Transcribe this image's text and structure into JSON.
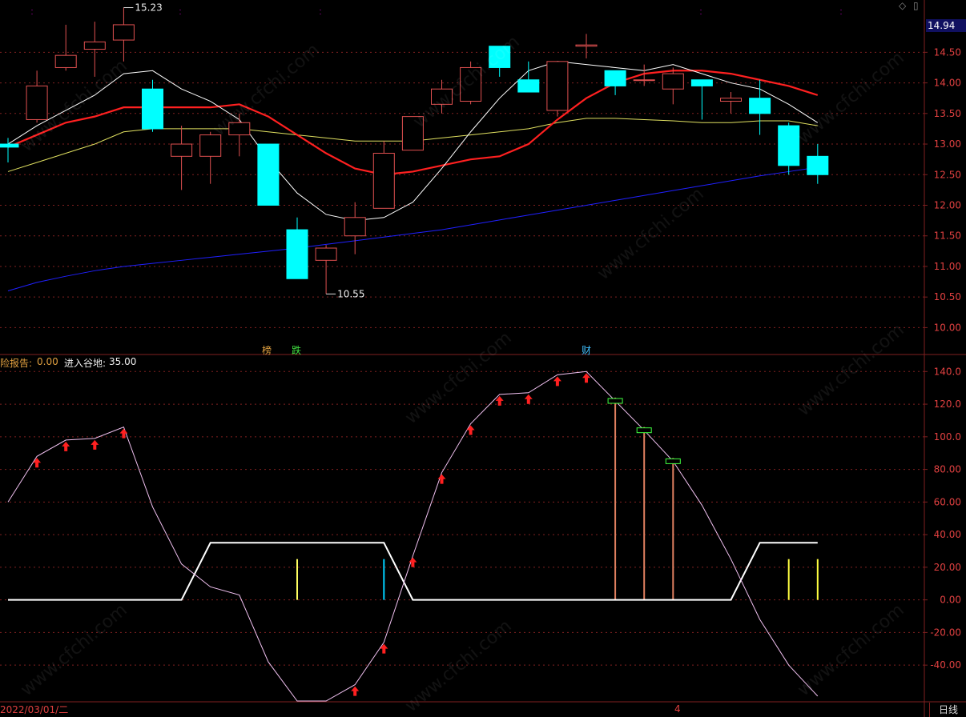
{
  "indicator_labels": {
    "item1_label": "险报告:",
    "item1_value": "0.00",
    "item2_label": "进入谷地:",
    "item2_value": "35.00"
  },
  "badges": [
    {
      "text": "榜",
      "color": "#e0a040"
    },
    {
      "text": "跌",
      "color": "#40e040"
    },
    {
      "text": "财",
      "color": "#40c0ff"
    }
  ],
  "current_price": "14.94",
  "date_label": "2022/03/01/二",
  "period": "日线",
  "marker": "4",
  "watermark": "www.cfchi.com",
  "colors": {
    "up": "#e05050",
    "down": "#00ffff",
    "ma5": "#ffffff",
    "ma10": "#ff2020",
    "ma20": "#e0e060",
    "ma60": "#2020ff",
    "grid": "#802020"
  },
  "chart_data": [
    {
      "type": "candlestick",
      "y_ticks": [
        "14.50",
        "14.00",
        "13.50",
        "13.00",
        "12.50",
        "12.00",
        "11.50",
        "11.00",
        "10.50",
        "10.00"
      ],
      "ylim": [
        9.6,
        15.25
      ],
      "annotations": [
        {
          "text": "15.23",
          "value": 15.23
        },
        {
          "text": "10.55",
          "value": 10.55
        }
      ],
      "candles": [
        {
          "o": 13.0,
          "c": 12.95,
          "h": 13.1,
          "l": 12.7
        },
        {
          "o": 13.4,
          "c": 13.95,
          "h": 14.2,
          "l": 13.35
        },
        {
          "o": 14.25,
          "c": 14.45,
          "h": 14.95,
          "l": 14.2
        },
        {
          "o": 14.55,
          "c": 14.67,
          "h": 15.0,
          "l": 14.1
        },
        {
          "o": 14.7,
          "c": 14.95,
          "h": 15.23,
          "l": 14.35
        },
        {
          "o": 13.9,
          "c": 13.25,
          "h": 14.05,
          "l": 13.2
        },
        {
          "o": 12.8,
          "c": 13.0,
          "h": 13.3,
          "l": 12.25
        },
        {
          "o": 12.8,
          "c": 13.15,
          "h": 13.2,
          "l": 12.35
        },
        {
          "o": 13.15,
          "c": 13.35,
          "h": 13.5,
          "l": 12.8
        },
        {
          "o": 13.0,
          "c": 12.0,
          "h": 13.0,
          "l": 12.0
        },
        {
          "o": 11.6,
          "c": 10.8,
          "h": 11.8,
          "l": 10.8
        },
        {
          "o": 11.1,
          "c": 11.3,
          "h": 11.35,
          "l": 10.55
        },
        {
          "o": 11.5,
          "c": 11.8,
          "h": 12.05,
          "l": 11.2
        },
        {
          "o": 11.95,
          "c": 12.85,
          "h": 13.05,
          "l": 11.95
        },
        {
          "o": 12.9,
          "c": 13.45,
          "h": 13.45,
          "l": 12.9
        },
        {
          "o": 13.65,
          "c": 13.9,
          "h": 14.05,
          "l": 13.5
        },
        {
          "o": 13.7,
          "c": 14.25,
          "h": 14.35,
          "l": 13.65
        },
        {
          "o": 14.6,
          "c": 14.25,
          "h": 14.6,
          "l": 14.1
        },
        {
          "o": 14.05,
          "c": 13.85,
          "h": 14.35,
          "l": 13.85
        },
        {
          "o": 13.55,
          "c": 14.35,
          "h": 14.35,
          "l": 13.45
        },
        {
          "o": 14.6,
          "c": 14.62,
          "h": 14.8,
          "l": 14.4
        },
        {
          "o": 14.2,
          "c": 13.95,
          "h": 14.2,
          "l": 13.8
        },
        {
          "o": 14.05,
          "c": 14.05,
          "h": 14.3,
          "l": 13.95
        },
        {
          "o": 13.9,
          "c": 14.15,
          "h": 14.25,
          "l": 13.65
        },
        {
          "o": 14.05,
          "c": 13.95,
          "h": 14.05,
          "l": 13.4
        },
        {
          "o": 13.7,
          "c": 13.75,
          "h": 13.85,
          "l": 13.5
        },
        {
          "o": 13.75,
          "c": 13.5,
          "h": 14.05,
          "l": 13.15
        },
        {
          "o": 13.3,
          "c": 12.65,
          "h": 13.35,
          "l": 12.5
        },
        {
          "o": 12.8,
          "c": 12.5,
          "h": 13.0,
          "l": 12.35
        }
      ],
      "ma5": [
        13.0,
        13.3,
        13.55,
        13.8,
        14.15,
        14.2,
        13.9,
        13.7,
        13.4,
        12.75,
        12.2,
        11.85,
        11.75,
        11.8,
        12.05,
        12.6,
        13.2,
        13.75,
        14.2,
        14.35,
        14.3,
        14.25,
        14.2,
        14.3,
        14.15,
        14.0,
        13.9,
        13.65,
        13.35
      ],
      "ma10": [
        12.95,
        13.15,
        13.35,
        13.45,
        13.6,
        13.6,
        13.6,
        13.6,
        13.65,
        13.45,
        13.15,
        12.85,
        12.6,
        12.5,
        12.55,
        12.65,
        12.75,
        12.8,
        13.0,
        13.4,
        13.75,
        14.0,
        14.15,
        14.2,
        14.2,
        14.15,
        14.05,
        13.95,
        13.8
      ],
      "ma20": [
        12.55,
        12.7,
        12.85,
        13.0,
        13.2,
        13.25,
        13.25,
        13.25,
        13.25,
        13.2,
        13.15,
        13.1,
        13.05,
        13.05,
        13.05,
        13.1,
        13.15,
        13.2,
        13.25,
        13.35,
        13.42,
        13.42,
        13.4,
        13.38,
        13.35,
        13.35,
        13.38,
        13.38,
        13.3
      ],
      "ma60": [
        10.6,
        10.74,
        10.84,
        10.93,
        11.0,
        11.05,
        11.1,
        11.15,
        11.2,
        11.25,
        11.3,
        11.36,
        11.42,
        11.48,
        11.54,
        11.6,
        11.68,
        11.76,
        11.84,
        11.92,
        12.0,
        12.08,
        12.16,
        12.24,
        12.32,
        12.4,
        12.48,
        12.55,
        12.62
      ]
    },
    {
      "type": "line",
      "y_ticks": [
        "140.0",
        "120.0",
        "100.0",
        "80.00",
        "60.00",
        "40.00",
        "20.00",
        "0.00",
        "-20.00",
        "-40.00"
      ],
      "ylim": [
        -62,
        148
      ],
      "series": [
        {
          "values": [
            60,
            88,
            98,
            99,
            106,
            57,
            22,
            8,
            3,
            -38,
            -62,
            -62,
            -52,
            -26,
            27,
            78,
            108,
            126,
            127,
            138,
            140,
            122,
            104,
            85,
            58,
            25,
            -12,
            -40,
            -59
          ]
        },
        {
          "values": [
            0,
            0,
            0,
            0,
            0,
            0,
            0,
            35,
            35,
            35,
            35,
            35,
            35,
            35,
            0,
            0,
            0,
            0,
            0,
            0,
            0,
            0,
            0,
            0,
            0,
            0,
            35,
            35,
            35
          ]
        }
      ],
      "up_arrows": [
        1,
        2,
        3,
        4,
        12,
        13,
        14,
        15,
        16,
        17,
        18,
        19,
        20
      ],
      "boxes": [
        21,
        22,
        23
      ],
      "vertical_bars": [
        {
          "i": 10,
          "top": 25,
          "color": "#ffff60"
        },
        {
          "i": 13,
          "top": 25,
          "color": "#00d0ff"
        },
        {
          "i": 21,
          "top": 124,
          "color": "#e08060"
        },
        {
          "i": 22,
          "top": 106,
          "color": "#e08060"
        },
        {
          "i": 23,
          "top": 87,
          "color": "#e08060"
        },
        {
          "i": 27,
          "top": 25,
          "color": "#ffff40"
        },
        {
          "i": 28,
          "top": 25,
          "color": "#ffff40"
        }
      ]
    }
  ]
}
